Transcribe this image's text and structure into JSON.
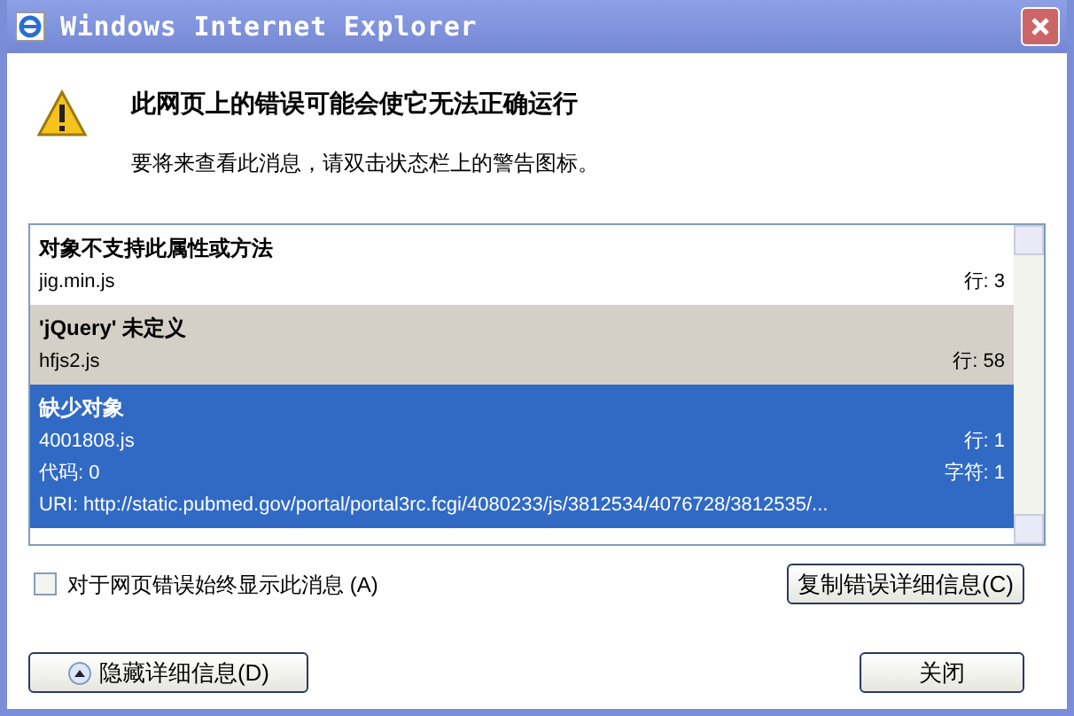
{
  "window": {
    "title": "Windows Internet Explorer"
  },
  "heading": "此网页上的错误可能会使它无法正确运行",
  "subtext": "要将来查看此消息，请双击状态栏上的警告图标。",
  "errors": [
    {
      "title": "对象不支持此属性或方法",
      "shaded": false,
      "selected": false,
      "lines": [
        {
          "left": "jig.min.js",
          "right": "行: 3"
        }
      ]
    },
    {
      "title": "'jQuery' 未定义",
      "shaded": true,
      "selected": false,
      "lines": [
        {
          "left": "hfjs2.js",
          "right": "行: 58"
        }
      ]
    },
    {
      "title": "缺少对象",
      "shaded": false,
      "selected": true,
      "lines": [
        {
          "left": "4001808.js",
          "right": "行: 1"
        },
        {
          "left": "代码: 0",
          "right": "字符: 1"
        },
        {
          "left": "URI: http://static.pubmed.gov/portal/portal3rc.fcgi/4080233/js/3812534/4076728/3812535/..."
        }
      ]
    }
  ],
  "always_show": {
    "label": "对于网页错误始终显示此消息 (A)",
    "checked": false
  },
  "copy_button": "复制错误详细信息(C)",
  "details_button": "隐藏详细信息(D)",
  "close_button": "关闭"
}
